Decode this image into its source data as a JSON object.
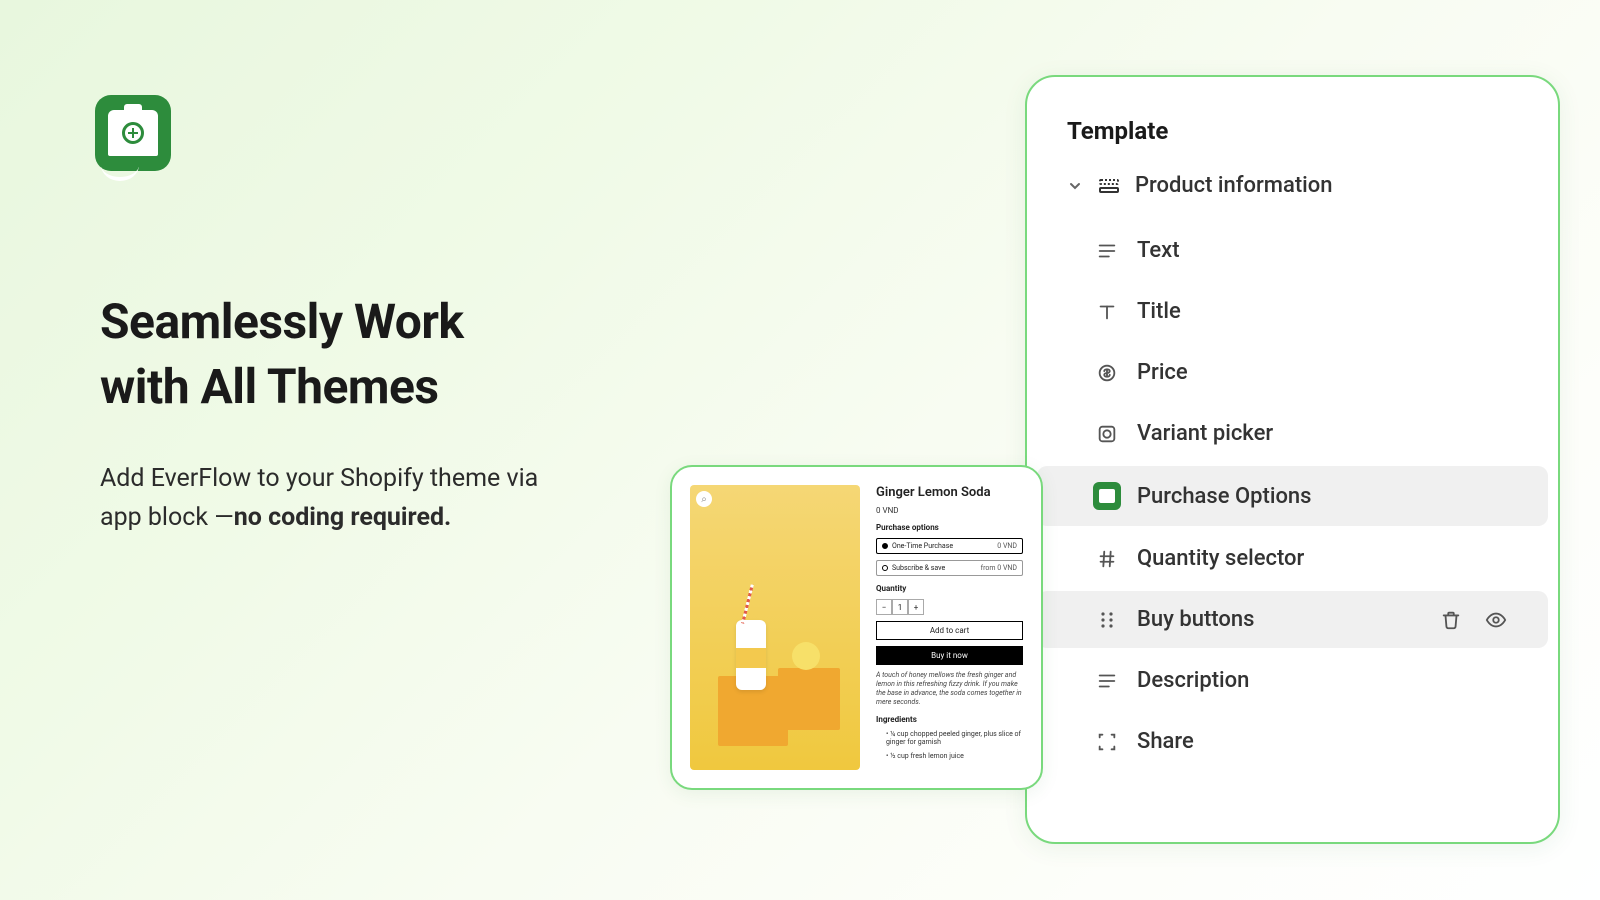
{
  "heading_line1": "Seamlessly Work",
  "heading_line2": "with All Themes",
  "subhead_pre": "Add EverFlow to your Shopify theme via app block —",
  "subhead_bold": "no coding required.",
  "template_panel": {
    "title": "Template",
    "root": "Product information",
    "items": [
      {
        "label": "Text",
        "icon": "text"
      },
      {
        "label": "Title",
        "icon": "title"
      },
      {
        "label": "Price",
        "icon": "price"
      },
      {
        "label": "Variant picker",
        "icon": "variant"
      },
      {
        "label": "Purchase Options",
        "icon": "app",
        "highlight": true
      },
      {
        "label": "Quantity selector",
        "icon": "hash"
      },
      {
        "label": "Buy buttons",
        "icon": "drag",
        "highlight": true,
        "actions": true
      },
      {
        "label": "Description",
        "icon": "text"
      },
      {
        "label": "Share",
        "icon": "share"
      }
    ]
  },
  "preview": {
    "title": "Ginger Lemon Soda",
    "price": "0 VND",
    "purchase_label": "Purchase options",
    "opt1": "One-Time Purchase",
    "opt1_price": "0 VND",
    "opt2": "Subscribe & save",
    "opt2_price": "from 0 VND",
    "qty_label": "Quantity",
    "qty_value": "1",
    "add_cart": "Add to cart",
    "buy_now": "Buy it now",
    "desc": "A touch of honey mellows the fresh ginger and lemon in this refreshing fizzy drink. If you make the base in advance, the soda comes together in mere seconds.",
    "ingredients_label": "Ingredients",
    "ing1": "¼ cup chopped peeled ginger, plus slice of ginger for garnish",
    "ing2": "½ cup fresh lemon juice"
  }
}
